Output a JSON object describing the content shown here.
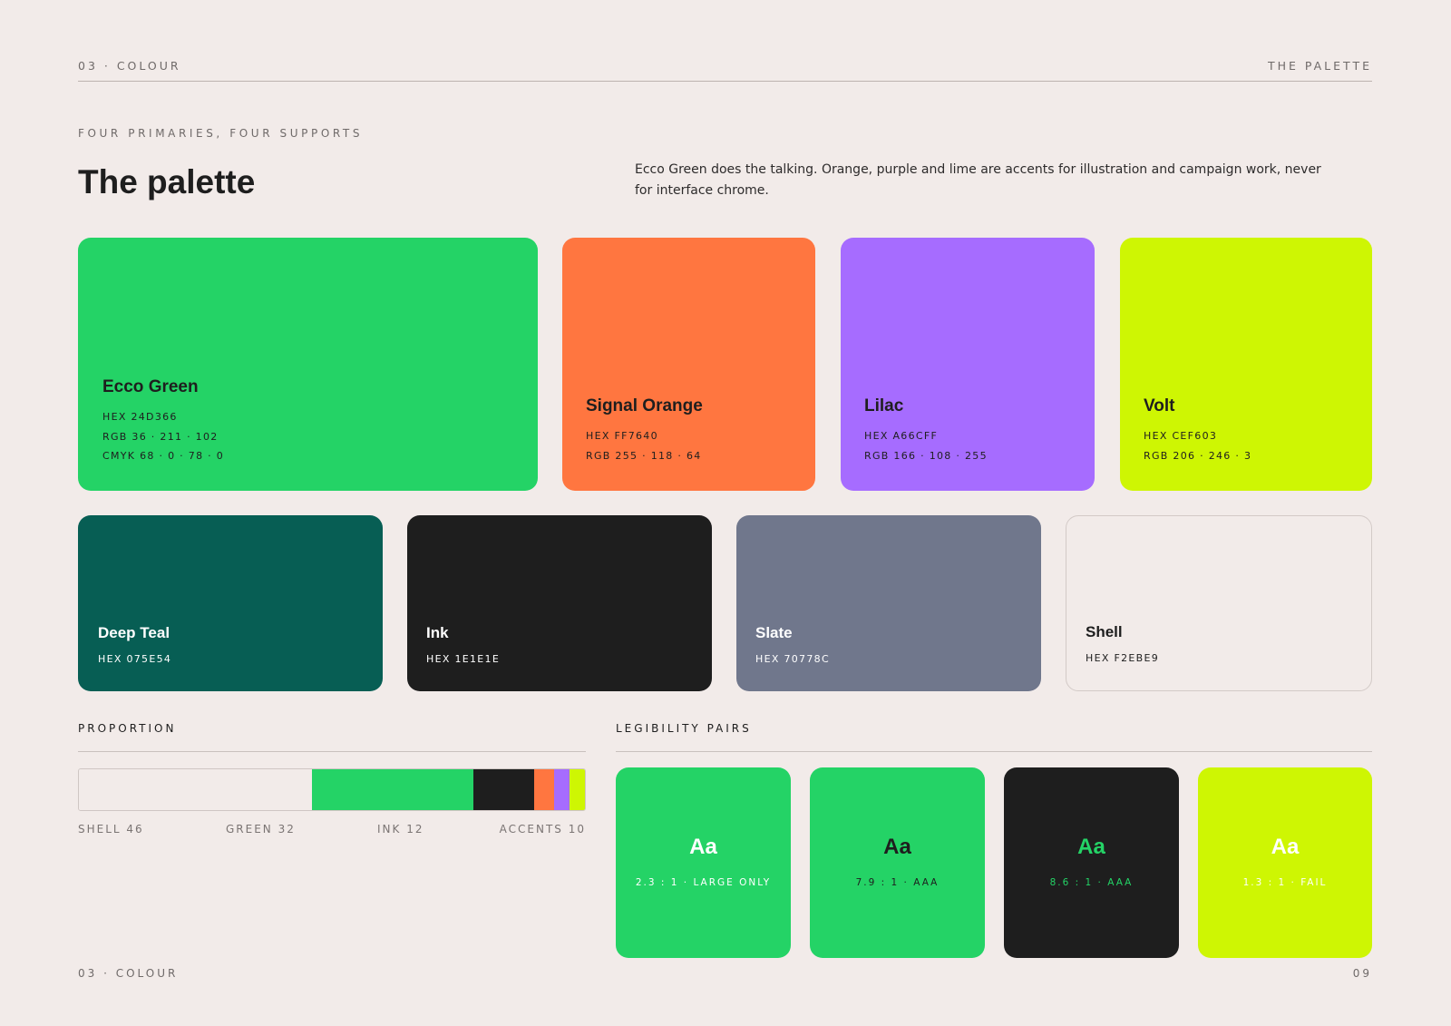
{
  "header": {
    "section": "03 · COLOUR",
    "page_label": "THE PALETTE"
  },
  "intro": {
    "kicker": "FOUR PRIMARIES, FOUR SUPPORTS",
    "title": "The palette",
    "description": "Ecco Green does the talking. Orange, purple and lime are accents for illustration and campaign work, never for interface chrome."
  },
  "primaries": [
    {
      "name": "Ecco Green",
      "hex": "HEX 24D366",
      "rgb": "RGB 36 · 211 · 102",
      "cmyk": "CMYK 68 · 0 · 78 · 0",
      "color": "#24D366",
      "text_color": "#1E1E1E"
    },
    {
      "name": "Signal Orange",
      "hex": "HEX FF7640",
      "rgb": "RGB 255 · 118 · 64",
      "color": "#FF7640",
      "text_color": "#1E1E1E"
    },
    {
      "name": "Lilac",
      "hex": "HEX A66CFF",
      "rgb": "RGB 166 · 108 · 255",
      "color": "#A66CFF",
      "text_color": "#1E1E1E"
    },
    {
      "name": "Volt",
      "hex": "HEX CEF603",
      "rgb": "RGB 206 · 246 · 3",
      "color": "#CEF603",
      "text_color": "#1E1E1E"
    }
  ],
  "supports": [
    {
      "name": "Deep Teal",
      "hex": "HEX 075E54",
      "color": "#075E54",
      "text_color": "#FFFFFF"
    },
    {
      "name": "Ink",
      "hex": "HEX 1E1E1E",
      "color": "#1E1E1E",
      "text_color": "#FFFFFF"
    },
    {
      "name": "Slate",
      "hex": "HEX 70778C",
      "color": "#70778C",
      "text_color": "#FFFFFF"
    },
    {
      "name": "Shell",
      "hex": "HEX F2EBE9",
      "color": "#F2EBE9",
      "text_color": "#1E1E1E"
    }
  ],
  "proportion": {
    "heading": "PROPORTION",
    "segments": [
      {
        "key": "shell",
        "percent": 46,
        "color": "#F2EBE9"
      },
      {
        "key": "green",
        "percent": 32,
        "color": "#24D366"
      },
      {
        "key": "ink",
        "percent": 12,
        "color": "#1E1E1E"
      },
      {
        "key": "orange",
        "percent": 4,
        "color": "#FF7640"
      },
      {
        "key": "lilac",
        "percent": 3,
        "color": "#A66CFF"
      },
      {
        "key": "volt",
        "percent": 3,
        "color": "#CEF603"
      }
    ],
    "labels": [
      "SHELL 46",
      "GREEN 32",
      "INK 12",
      "ACCENTS 10"
    ]
  },
  "legibility": {
    "heading": "LEGIBILITY PAIRS",
    "pairs": [
      {
        "sample": "Aa",
        "ratio": "2.3 : 1 · LARGE ONLY",
        "bg": "#24D366",
        "fg": "#FFFFFF"
      },
      {
        "sample": "Aa",
        "ratio": "7.9 : 1 · AAA",
        "bg": "#24D366",
        "fg": "#1E1E1E"
      },
      {
        "sample": "Aa",
        "ratio": "8.6 : 1 · AAA",
        "bg": "#1E1E1E",
        "fg": "#24D366"
      },
      {
        "sample": "Aa",
        "ratio": "1.3 : 1 · FAIL",
        "bg": "#CEF603",
        "fg": "#FFFFFF"
      }
    ]
  },
  "footer": {
    "section": "03 · COLOUR",
    "page_number": "09"
  }
}
